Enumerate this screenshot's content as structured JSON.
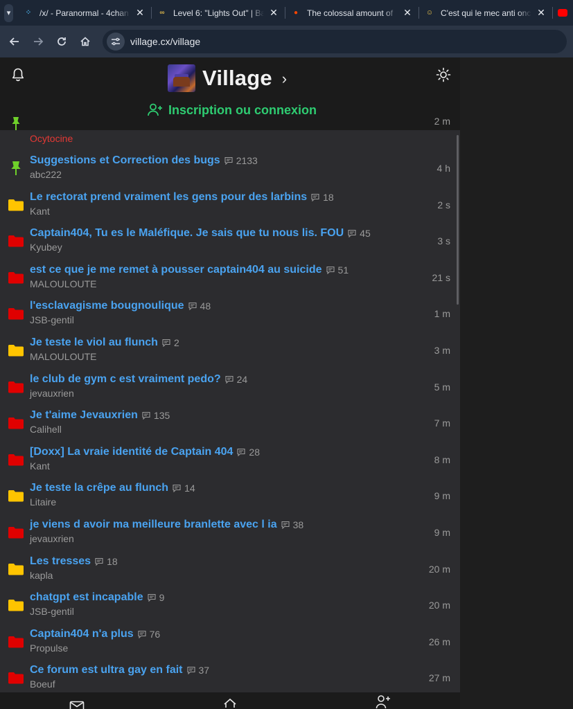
{
  "browser": {
    "tabs": [
      {
        "title": "/x/ - Paranormal - 4chan",
        "favicon": "4chan-icon",
        "color": "#4ab0e8"
      },
      {
        "title": "Level 6: \"Lights Out\" | Ba",
        "favicon": "glasses-icon",
        "color": "#d8b44a"
      },
      {
        "title": "The colossal amount of",
        "favicon": "reddit-icon",
        "color": "#ff4500"
      },
      {
        "title": "C'est qui le mec anti onc",
        "favicon": "smiley-icon",
        "color": "#f2c94c"
      }
    ],
    "url": "village.cx/village"
  },
  "header": {
    "title": "Village",
    "chevron": "›",
    "login_label": "Inscription ou connexion",
    "accent_color": "#2ecc71"
  },
  "top_partial": {
    "author": "Ocytocine",
    "time": "2 m"
  },
  "threads": [
    {
      "title": "Suggestions et Correction des bugs",
      "comments": "2133",
      "author": "abc222",
      "time": "4 h",
      "icon": "pin-icon"
    },
    {
      "title": "Le rectorat prend vraiment les gens pour des larbins",
      "comments": "18",
      "author": "Kant",
      "time": "2 s",
      "icon": "folder-yellow-icon"
    },
    {
      "title": "Captain404, Tu es le Maléfique. Je sais que tu nous lis. FOU",
      "comments": "45",
      "author": "Kyubey",
      "time": "3 s",
      "icon": "folder-red-icon"
    },
    {
      "title": "est ce que je me remet à pousser captain404 au suicide",
      "comments": "51",
      "author": "MALOULOUTE",
      "time": "21 s",
      "icon": "folder-red-icon"
    },
    {
      "title": "l'esclavagisme bougnoulique",
      "comments": "48",
      "author": "JSB-gentil",
      "time": "1 m",
      "icon": "folder-red-icon"
    },
    {
      "title": "Je teste le viol au flunch",
      "comments": "2",
      "author": "MALOULOUTE",
      "time": "3 m",
      "icon": "folder-yellow-icon"
    },
    {
      "title": "le club de gym c est vraiment pedo?",
      "comments": "24",
      "author": "jevauxrien",
      "time": "5 m",
      "icon": "folder-red-icon"
    },
    {
      "title": "Je t'aime Jevauxrien",
      "comments": "135",
      "author": "Calihell",
      "time": "7 m",
      "icon": "folder-red-icon"
    },
    {
      "title": "[Doxx] La vraie identité de Captain 404",
      "comments": "28",
      "author": "Kant",
      "time": "8 m",
      "icon": "folder-red-icon"
    },
    {
      "title": "Je teste la crêpe au flunch",
      "comments": "14",
      "author": "Litaire",
      "time": "9 m",
      "icon": "folder-yellow-icon"
    },
    {
      "title": "je viens d avoir ma meilleure branlette avec l ia",
      "comments": "38",
      "author": "jevauxrien",
      "time": "9 m",
      "icon": "folder-red-icon"
    },
    {
      "title": "Les tresses",
      "comments": "18",
      "author": "kapla",
      "time": "20 m",
      "icon": "folder-yellow-icon"
    },
    {
      "title": "chatgpt est incapable",
      "comments": "9",
      "author": "JSB-gentil",
      "time": "20 m",
      "icon": "folder-yellow-icon"
    },
    {
      "title": "Captain404 n'a plus",
      "comments": "76",
      "author": "Propulse",
      "time": "26 m",
      "icon": "folder-red-icon"
    },
    {
      "title": "Ce forum est ultra gay en fait",
      "comments": "37",
      "author": "Boeuf",
      "time": "27 m",
      "icon": "folder-red-icon"
    }
  ],
  "colors": {
    "title_link": "#4aa3f0",
    "folder_red": "#e00000",
    "folder_yellow": "#ffc400",
    "pin_green": "#6fd12a"
  },
  "bottom_nav": [
    {
      "icon": "mail-icon"
    },
    {
      "icon": "home-icon"
    },
    {
      "icon": "add-user-icon"
    }
  ]
}
